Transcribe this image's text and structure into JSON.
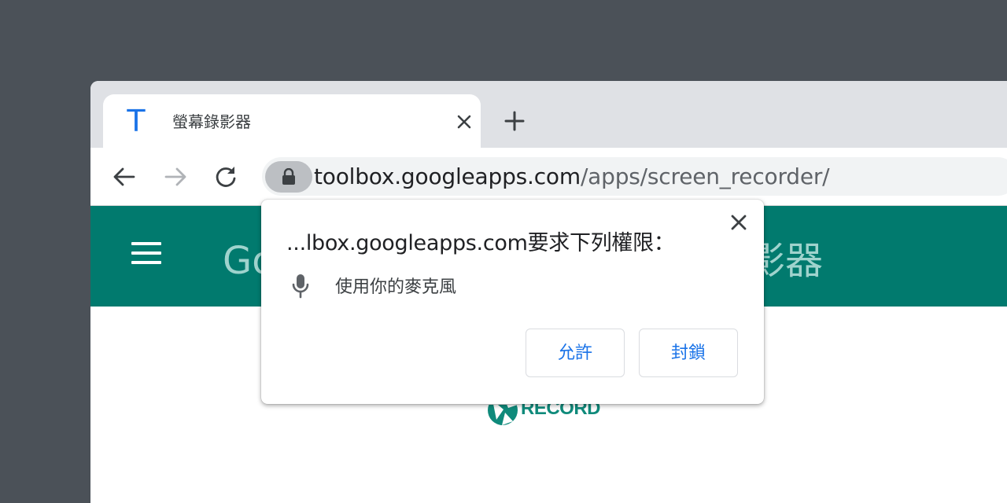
{
  "tab": {
    "favicon_letter": "T",
    "title": "螢幕錄影器"
  },
  "omnibox": {
    "url_host": "toolbox.googleapps.com",
    "url_path": "/apps/screen_recorder/"
  },
  "appbar": {
    "title_visible_start": "Go",
    "title_visible_end": "影器"
  },
  "page": {
    "record_label": "RECORD"
  },
  "permission_dialog": {
    "title": "...lbox.googleapps.com要求下列權限：",
    "permission_text": "使用你的麥克風",
    "allow_label": "允許",
    "block_label": "封鎖"
  },
  "icons": {
    "close": "close-icon",
    "new_tab": "plus-icon",
    "back": "arrow-left-icon",
    "forward": "arrow-right-icon",
    "reload": "reload-icon",
    "lock": "lock-icon",
    "menu": "hamburger-icon",
    "mic": "microphone-icon"
  },
  "colors": {
    "desktop": "#4b5158",
    "tabstrip": "#dfe1e5",
    "appbar": "#017a6e",
    "link_blue": "#1a73e8",
    "record_teal": "#0f8a7b"
  }
}
